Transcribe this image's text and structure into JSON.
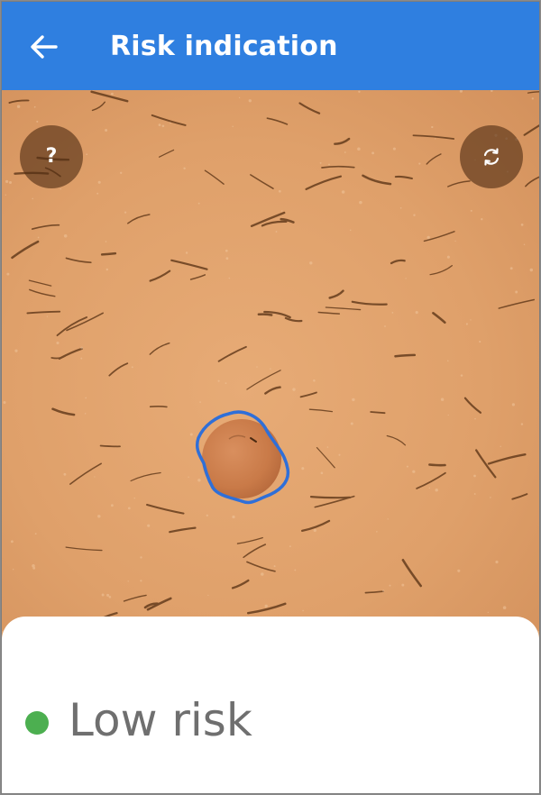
{
  "header": {
    "title": "Risk indication",
    "back_icon": "arrow-left-icon",
    "background_color": "#2f7fe0"
  },
  "photo": {
    "subject": "skin lesion photo",
    "lesion_outline_color": "#2f6fd8"
  },
  "controls": {
    "help": {
      "icon": "question-mark-icon",
      "glyph": "?"
    },
    "refresh": {
      "icon": "refresh-icon"
    }
  },
  "result": {
    "label": "Low risk",
    "status_color": "#4caf50"
  }
}
